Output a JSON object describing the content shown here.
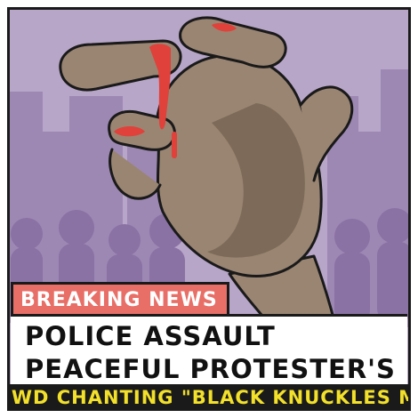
{
  "badge": {
    "label": "BREAKING NEWS",
    "color": "#e76f67"
  },
  "headline": {
    "text": "POLICE ASSAULT PEACEFUL PROTESTER'S FIST"
  },
  "ticker": {
    "text": "OWD CHANTING \"BLACK KNUCKLES MATT",
    "color": "#f2e02a"
  },
  "colors": {
    "background": "#b8a6c9",
    "buildings": "#9d88b3",
    "crowd": "#8a72a4",
    "hand": "#9a8572",
    "hand_shadow": "#7d6a59",
    "blood": "#e0413a"
  }
}
